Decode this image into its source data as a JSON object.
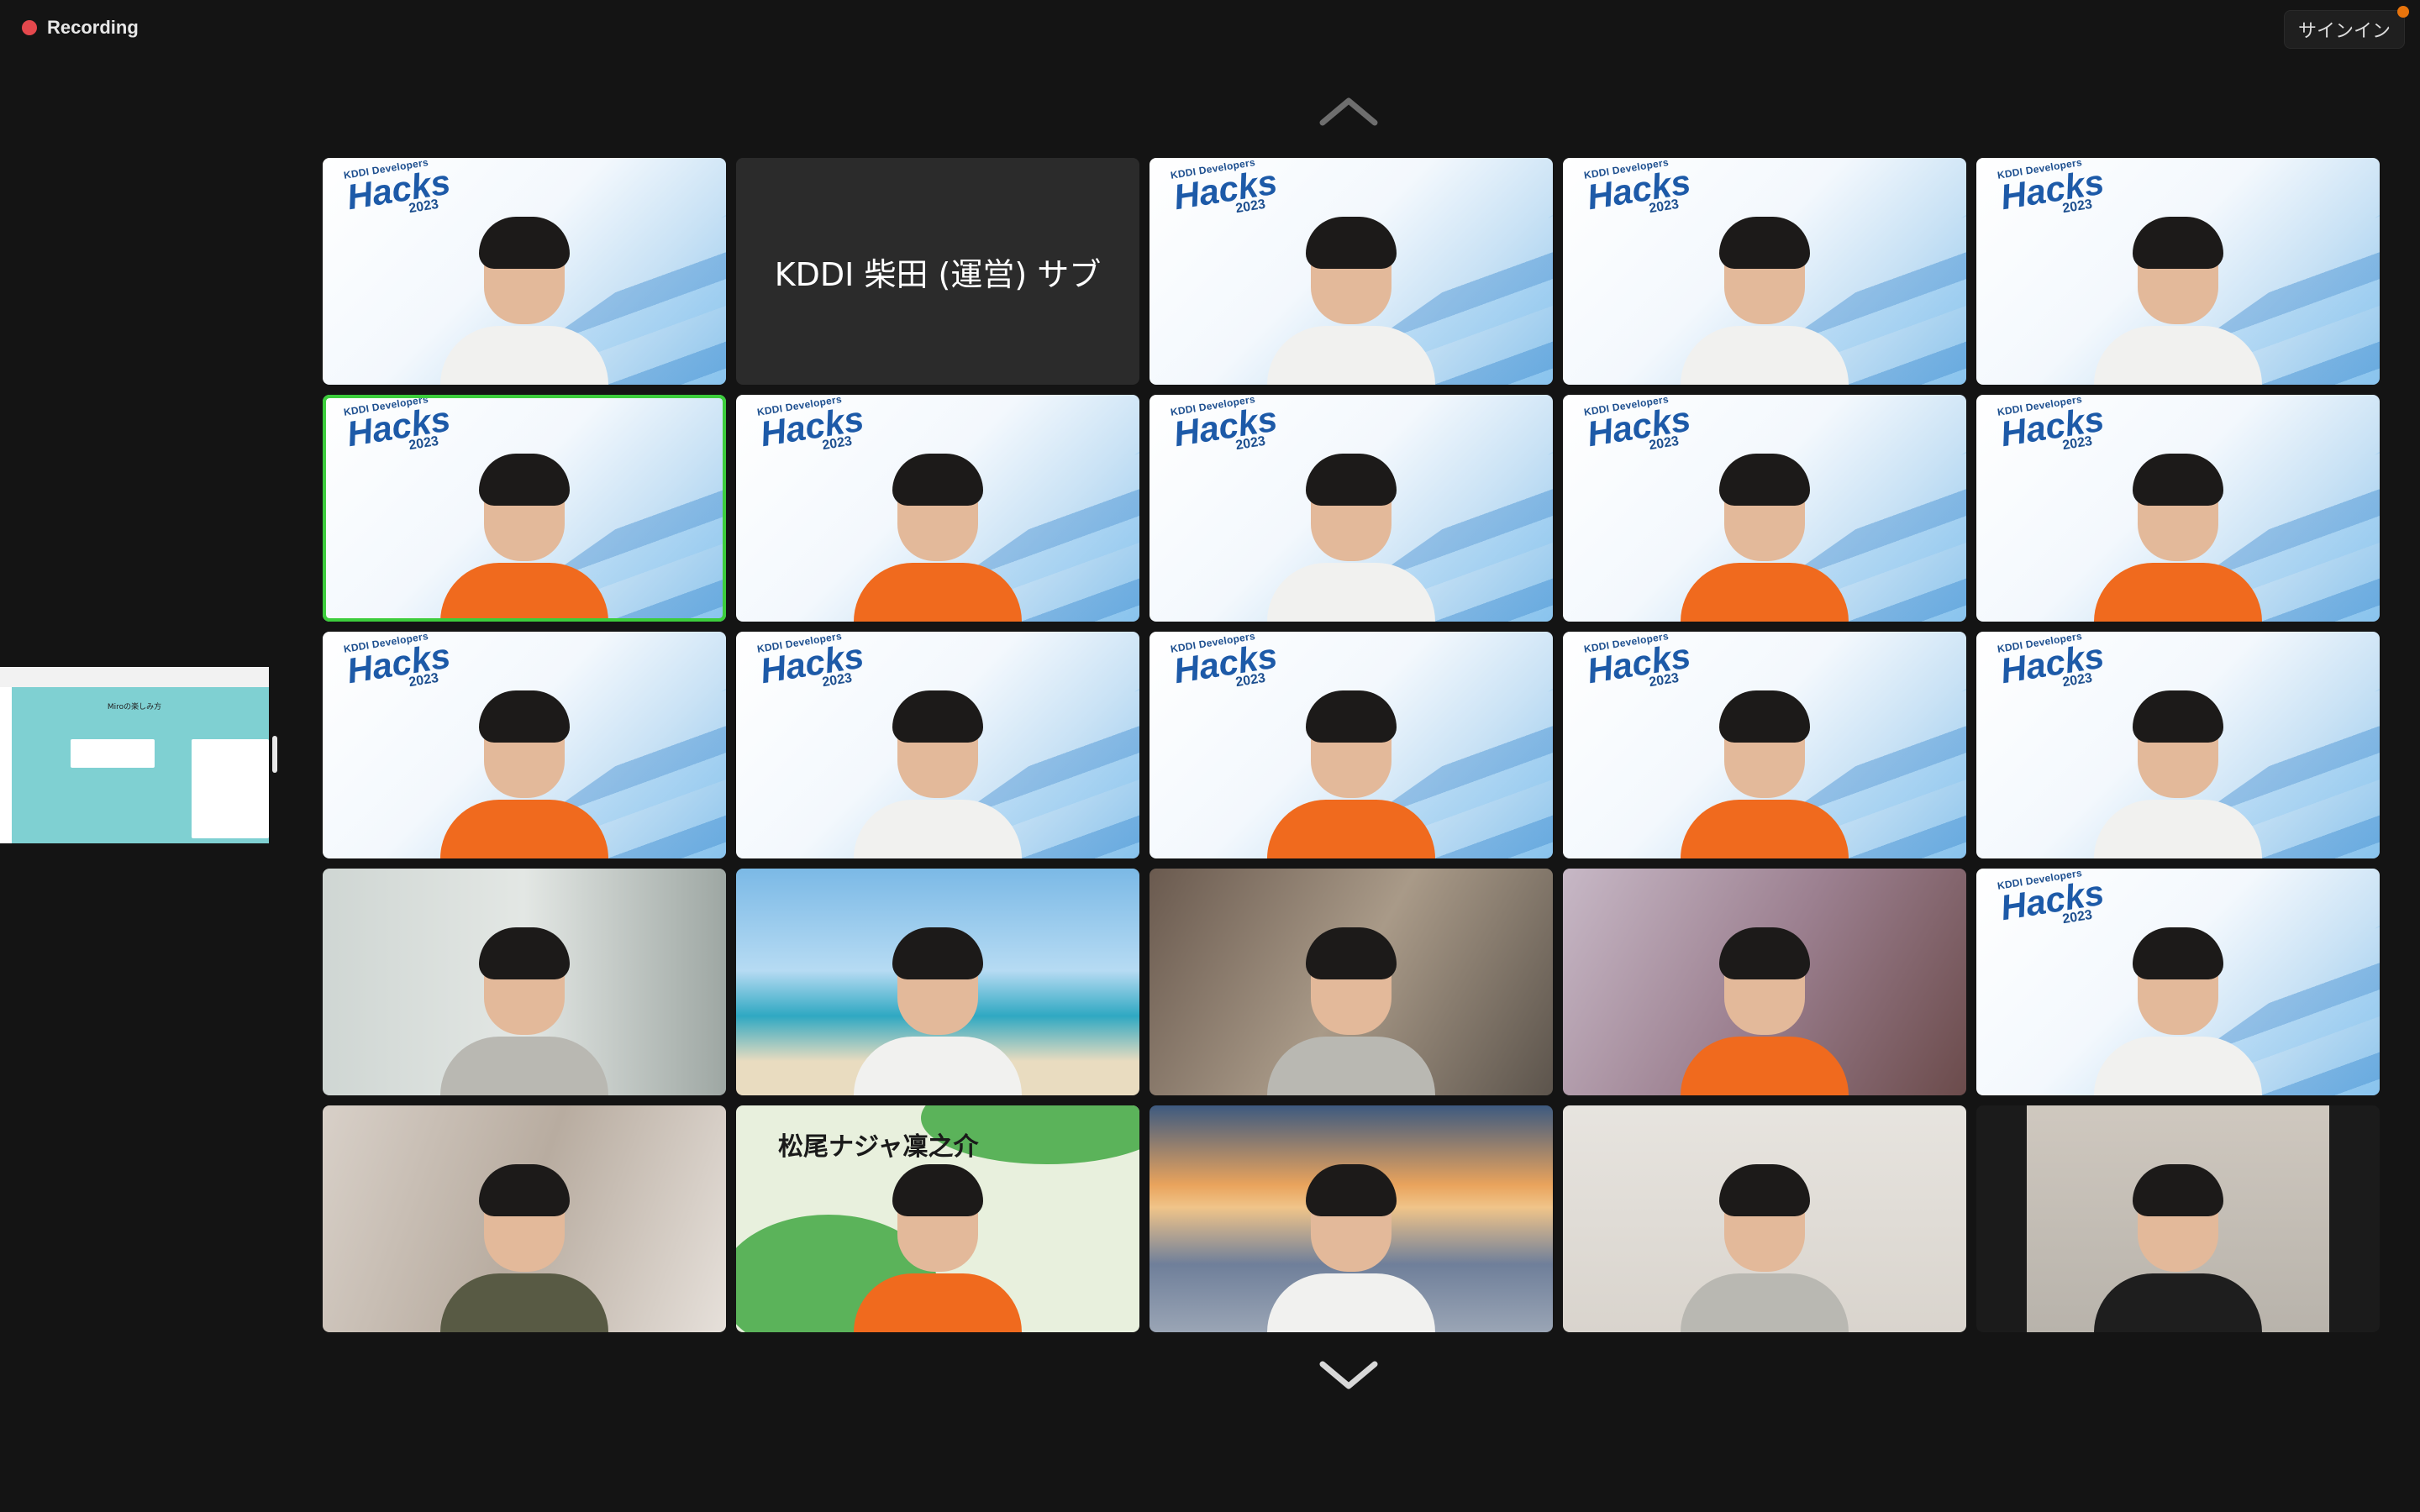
{
  "recording": {
    "label": "Recording",
    "color": "#e5484d"
  },
  "signin": {
    "label": "サインイン"
  },
  "nav": {
    "up_icon": "chevron-up-icon",
    "down_icon": "chevron-down-icon"
  },
  "logo": {
    "line1": "KDDI Developers",
    "line2": "Hacks",
    "line3": "2023"
  },
  "active_speaker_color": "#3ccd3c",
  "participants": [
    {
      "background": "hacks",
      "shirt": "white"
    },
    {
      "background": "name",
      "name": "KDDI 柴田 (運営) サブ"
    },
    {
      "background": "hacks",
      "shirt": "white"
    },
    {
      "background": "hacks",
      "shirt": "white"
    },
    {
      "background": "hacks",
      "shirt": "white"
    },
    {
      "background": "hacks",
      "shirt": "orange",
      "active": true
    },
    {
      "background": "hacks",
      "shirt": "orange"
    },
    {
      "background": "hacks",
      "shirt": "white"
    },
    {
      "background": "hacks",
      "shirt": "orange"
    },
    {
      "background": "hacks",
      "shirt": "orange"
    },
    {
      "background": "hacks",
      "shirt": "orange"
    },
    {
      "background": "hacks",
      "shirt": "white"
    },
    {
      "background": "hacks",
      "shirt": "orange"
    },
    {
      "background": "hacks",
      "shirt": "orange"
    },
    {
      "background": "hacks",
      "shirt": "white"
    },
    {
      "background": "grey-room",
      "shirt": "grey"
    },
    {
      "background": "beach",
      "shirt": "white"
    },
    {
      "background": "room",
      "shirt": "grey"
    },
    {
      "background": "pink-room",
      "shirt": "orange"
    },
    {
      "background": "hacks",
      "shirt": "white"
    },
    {
      "background": "office",
      "shirt": "olive"
    },
    {
      "background": "green-plate",
      "name": "松尾ナジャ凜之介",
      "shirt": "orange"
    },
    {
      "background": "bridge",
      "shirt": "white"
    },
    {
      "background": "white-wall",
      "shirt": "grey"
    },
    {
      "background": "dark-frame",
      "shirt": "black"
    }
  ],
  "shared_screen": {
    "title": "Miroの楽しみ方"
  }
}
